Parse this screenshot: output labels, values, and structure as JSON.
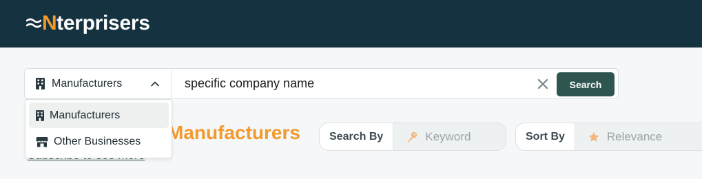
{
  "header": {
    "logo": {
      "mark": "≈",
      "letter": "N",
      "rest": "terprisers"
    }
  },
  "search": {
    "category_selected": "Manufacturers",
    "query": "specific company name",
    "button_label": "Search"
  },
  "dropdown": {
    "items": [
      {
        "label": "Manufacturers",
        "icon": "building-icon",
        "active": true
      },
      {
        "label": "Other Businesses",
        "icon": "store-icon",
        "active": false
      }
    ]
  },
  "section": {
    "title": "Manufacturers",
    "subscribe_link": "Subscribe to see more"
  },
  "search_by": {
    "label": "Search By",
    "value": "Keyword",
    "icon": "key-icon"
  },
  "sort_by": {
    "label": "Sort By",
    "value": "Relevance",
    "icon": "star-icon"
  },
  "colors": {
    "header_bg": "#153240",
    "accent": "#f29a2e",
    "button_bg": "#2f5550"
  }
}
